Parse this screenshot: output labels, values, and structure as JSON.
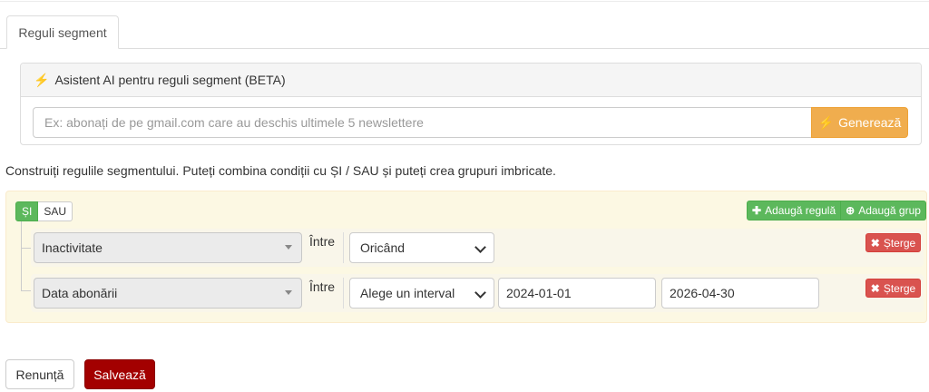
{
  "tabs": [
    {
      "label": "Reguli segment",
      "active": true
    }
  ],
  "ai_assistant": {
    "title": "Asistent AI pentru reguli segment (BETA)",
    "title_icon": "bolt-icon",
    "input_placeholder": "Ex: abonați de pe gmail.com care au deschis ultimele 5 newslettere",
    "input_value": "",
    "generate_label": "Generează",
    "generate_icon": "bolt-icon"
  },
  "hint_text": "Construiți regulile segmentului. Puteți combina condiții cu ȘI / SAU și puteți crea grupuri imbricate.",
  "group": {
    "logic_options": [
      "ȘI",
      "SAU"
    ],
    "selected_logic": "ȘI",
    "add_rule_label": "Adaugă regulă",
    "add_group_label": "Adaugă grup"
  },
  "rules": [
    {
      "field": "Inactivitate",
      "operator_label": "Între",
      "value_select": "Oricând",
      "date_from": null,
      "date_to": null,
      "delete_label": "Șterge"
    },
    {
      "field": "Data abonării",
      "operator_label": "Între",
      "value_select": "Alege un interval",
      "date_from": "2024-01-01",
      "date_to": "2026-04-30",
      "delete_label": "Șterge"
    }
  ],
  "footer": {
    "cancel_label": "Renunță",
    "save_label": "Salvează"
  },
  "colors": {
    "warning": "#f0ad4e",
    "success": "#5cb85c",
    "danger": "#d9534f",
    "save": "#a30000",
    "rules_bg": "#fcf8e3"
  }
}
